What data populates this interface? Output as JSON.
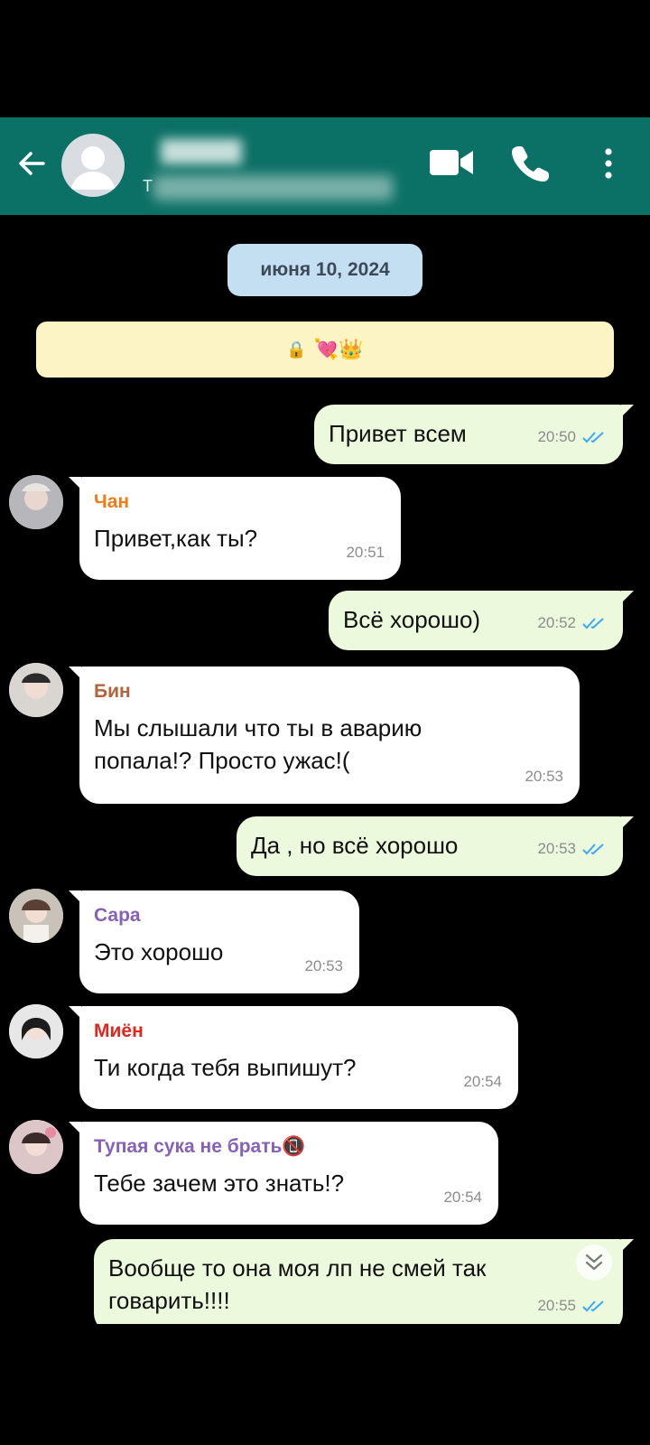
{
  "header": {
    "title": "",
    "subtitle": "Т",
    "icons": {
      "back": "arrow-left-icon",
      "avatar": "default-avatar-icon",
      "video": "video-camera-icon",
      "call": "phone-icon",
      "menu": "more-vertical-icon"
    }
  },
  "date_chip": "июня 10, 2024",
  "banner": {
    "emoji": "💘👑"
  },
  "messages": [
    {
      "dir": "out",
      "text": "Привет всем",
      "time": "20:50"
    },
    {
      "dir": "in",
      "sender": "Чан",
      "sender_color": "#ef7d1a",
      "text": "Привет,как ты?",
      "time": "20:51"
    },
    {
      "dir": "out",
      "text": "Всё хорошо)",
      "time": "20:52"
    },
    {
      "dir": "in",
      "sender": "Бин",
      "sender_color": "#b4643c",
      "text": "Мы слышали что ты в аварию попала!? Просто ужас!(",
      "time": "20:53"
    },
    {
      "dir": "out",
      "text": "Да , но всё хорошо",
      "time": "20:53"
    },
    {
      "dir": "in",
      "sender": "Сара",
      "sender_color": "#8660b9",
      "text": "Это хорошо",
      "time": "20:53"
    },
    {
      "dir": "in",
      "sender": "Миён",
      "sender_color": "#e2261c",
      "text": "Ти когда тебя выпишут?",
      "time": "20:54"
    },
    {
      "dir": "in",
      "sender": "Тупая сука не брать📵",
      "sender_color": "#8660b9",
      "text": "Тебе зачем это знать!?",
      "time": "20:54"
    },
    {
      "dir": "out",
      "text": "Вообще то она моя лп не смей так говарить!!!!",
      "time": "20:55"
    }
  ],
  "colors": {
    "header": "#0b7065",
    "outgoing": "#ecf9dc",
    "incoming": "#ffffff",
    "read_ticks": "#3aa8f2"
  }
}
